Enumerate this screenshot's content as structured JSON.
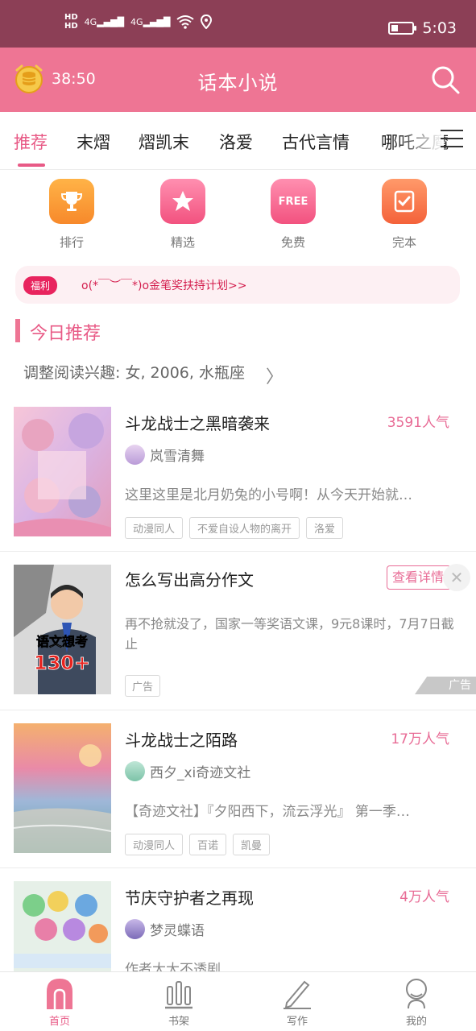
{
  "status_bar": {
    "hd1": "HD",
    "hd2": "HD",
    "signal1": "4G",
    "signal2": "4G",
    "time": "5:03",
    "icons": [
      "signal-icon",
      "wifi-icon",
      "location-icon",
      "battery-icon"
    ]
  },
  "header": {
    "timer": "38:50",
    "title": "话本小说",
    "accent_color": "#ee7594"
  },
  "tabs": [
    {
      "label": "推荐",
      "active": true
    },
    {
      "label": "末熠",
      "active": false
    },
    {
      "label": "熠凯末",
      "active": false
    },
    {
      "label": "洛爱",
      "active": false
    },
    {
      "label": "古代言情",
      "active": false
    },
    {
      "label": "哪吒之魔",
      "active": false
    }
  ],
  "quick": [
    {
      "label": "排行",
      "icon": "trophy-icon"
    },
    {
      "label": "精选",
      "icon": "star-icon"
    },
    {
      "label": "免费",
      "icon": "free-icon",
      "icon_text": "FREE"
    },
    {
      "label": "完本",
      "icon": "complete-icon"
    }
  ],
  "welfare": {
    "tag": "福利",
    "text": "o(*￣︶￣*)o金笔奖扶持计划>>"
  },
  "section": {
    "title": "今日推荐",
    "interest": "调整阅读兴趣: 女, 2006, 水瓶座"
  },
  "books": [
    {
      "title": "斗龙战士之黑暗袭来",
      "popularity": "3591人气",
      "author": "岚雪清舞",
      "intro": "这里这里是北月奶兔的小号啊！从今天开始就…",
      "tags": [
        "动漫同人",
        "不爱自设人物的离开",
        "洛爱"
      ]
    },
    {
      "title": "斗龙战士之陌路",
      "popularity": "17万人气",
      "author": "西夕_xi奇迹文社",
      "intro": "【奇迹文社】『夕阳西下，流云浮光』 第一季…",
      "tags": [
        "动漫同人",
        "百诺",
        "凯曼"
      ]
    },
    {
      "title": "节庆守护者之再现",
      "popularity": "4万人气",
      "author": "梦灵蝶语",
      "intro": "作者大大不透剧"
    }
  ],
  "ad": {
    "title": "怎么写出高分作文",
    "button": "查看详情",
    "description": "再不抢就没了，国家一等奖语文课，9元8课时，7月7日截止",
    "tag": "广告",
    "badge": "广告",
    "cover_text1": "语文想考",
    "cover_text2": "130+"
  },
  "bottom_nav": [
    {
      "label": "首页",
      "icon": "home-icon",
      "active": true
    },
    {
      "label": "书架",
      "icon": "bookshelf-icon",
      "active": false
    },
    {
      "label": "写作",
      "icon": "pen-icon",
      "active": false
    },
    {
      "label": "我的",
      "icon": "profile-icon",
      "active": false
    }
  ]
}
